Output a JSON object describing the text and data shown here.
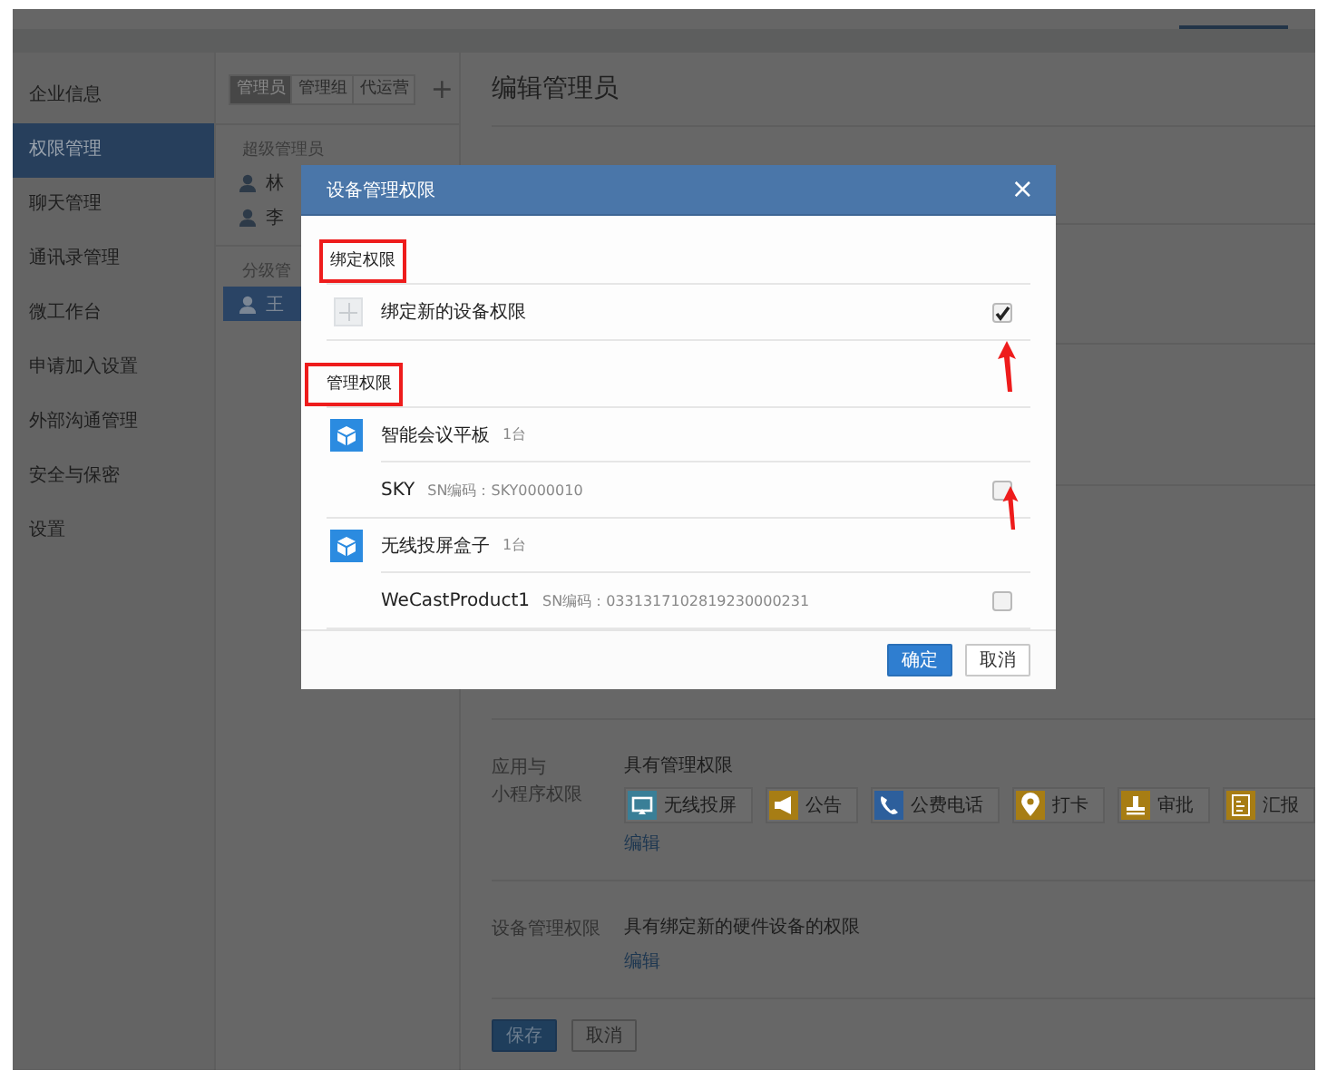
{
  "sidebar": {
    "items": [
      {
        "label": "企业信息",
        "selected": false
      },
      {
        "label": "权限管理",
        "selected": true
      },
      {
        "label": "聊天管理",
        "selected": false
      },
      {
        "label": "通讯录管理",
        "selected": false
      },
      {
        "label": "微工作台",
        "selected": false
      },
      {
        "label": "申请加入设置",
        "selected": false
      },
      {
        "label": "外部沟通管理",
        "selected": false
      },
      {
        "label": "安全与保密",
        "selected": false
      },
      {
        "label": "设置",
        "selected": false
      }
    ]
  },
  "admin_list": {
    "tabs": [
      {
        "label": "管理员",
        "selected": true
      },
      {
        "label": "管理组",
        "selected": false
      },
      {
        "label": "代运营",
        "selected": false
      }
    ],
    "add_button": "+",
    "groups": [
      {
        "title": "超级管理员",
        "members": [
          {
            "name": "林",
            "selected": false
          },
          {
            "name": "李",
            "selected": false
          }
        ]
      },
      {
        "title": "分级管",
        "members": [
          {
            "name": "王",
            "selected": true
          }
        ]
      }
    ]
  },
  "editor": {
    "title": "编辑管理员",
    "sections": [
      {
        "kind": "apps",
        "label_lines": [
          "应用与",
          "小程序权限"
        ],
        "value": "具有管理权限",
        "apps": [
          {
            "label": "无线投屏",
            "color": "#3a7f97"
          },
          {
            "label": "公告",
            "color": "#a77d14"
          },
          {
            "label": "公费电话",
            "color": "#2d5f9c"
          },
          {
            "label": "打卡",
            "color": "#a77d14"
          },
          {
            "label": "审批",
            "color": "#a77d14"
          },
          {
            "label": "汇报",
            "color": "#a77d14"
          }
        ],
        "link": "编辑"
      },
      {
        "kind": "text",
        "label_lines": [
          "设备管理权限"
        ],
        "value": "具有绑定新的硬件设备的权限",
        "link": "编辑"
      }
    ],
    "buttons": [
      {
        "label": "保存",
        "kind": "primary"
      },
      {
        "label": "取消",
        "kind": "default"
      }
    ]
  },
  "dialog": {
    "title": "设备管理权限",
    "close": "×",
    "sections": [
      {
        "label": "绑定权限",
        "highlighted": true,
        "rows": [
          {
            "kind": "bind",
            "label": "绑定新的设备权限",
            "checked": true,
            "arrow": true
          }
        ]
      },
      {
        "label": "管理权限",
        "highlighted": true,
        "rows": [
          {
            "kind": "group",
            "label": "智能会议平板",
            "count": "1台"
          },
          {
            "kind": "device",
            "label": "SKY",
            "serial": "SN编码：SKY0000010",
            "checked": false,
            "arrow": true
          },
          {
            "kind": "group",
            "label": "无线投屏盒子",
            "count": "1台"
          },
          {
            "kind": "device",
            "label": "WeCastProduct1",
            "serial": "SN编码：0331317102819230000231",
            "checked": false,
            "arrow": false
          }
        ]
      }
    ],
    "buttons": [
      {
        "label": "确定",
        "kind": "primary"
      },
      {
        "label": "取消",
        "kind": "default"
      }
    ]
  }
}
